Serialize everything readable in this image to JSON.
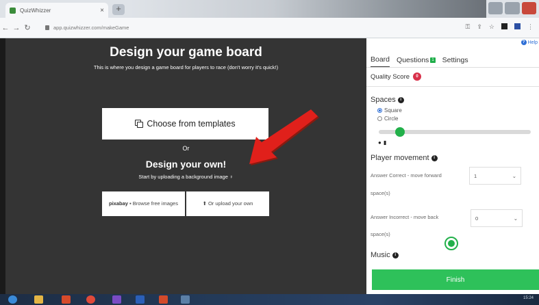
{
  "browser": {
    "tab_title": "QuizWhizzer",
    "tab_close": "×",
    "new_tab": "+",
    "url": "app.quizwhizzer.com/makeGame"
  },
  "main": {
    "title": "Design your game board",
    "subtitle": "This is where you design a game board for players to race (don't worry it's quick!)",
    "template_button": "Choose from templates",
    "or_label": "Or",
    "design_own_title": "Design your own!",
    "start_text": "Start by uploading a background image",
    "browse_logo": "pixabay",
    "browse_label": "Browse free images",
    "upload_label": "Or upload your own"
  },
  "panel": {
    "help_label": "Help",
    "tabs": [
      {
        "label": "Board"
      },
      {
        "label": "Questions",
        "badge": "1"
      },
      {
        "label": "Settings"
      }
    ],
    "quality_label": "Quality Score",
    "quality_badge": "0",
    "spaces_label": "Spaces",
    "space_options": [
      "Square",
      "Circle"
    ],
    "space_selected": "Square",
    "player_movement_label": "Player movement",
    "answer_correct_label": "Answer Correct - move forward",
    "answer_correct_value": "1",
    "answer_incorrect_label": "Answer Incorrect - move back",
    "answer_incorrect_value": "0",
    "spaces_unit": "space(s)",
    "music_label": "Music",
    "finish_button": "Finish"
  },
  "taskbar": {
    "clock": "15:24"
  },
  "colors": {
    "accent_green": "#2ec15a",
    "annotation_arrow": "#e0201b",
    "quality_badge": "#d8314a",
    "dark_background": "#343434"
  }
}
